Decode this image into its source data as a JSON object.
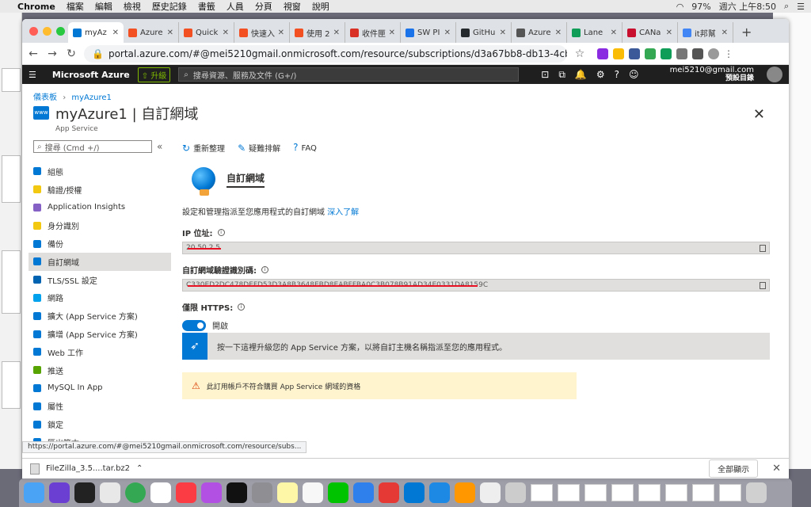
{
  "menubar": {
    "app": "Chrome",
    "items": [
      "檔案",
      "編輯",
      "檢視",
      "歷史記錄",
      "書籤",
      "人員",
      "分頁",
      "視窗",
      "說明"
    ],
    "battery": "97%",
    "clock": "週六 上午8:50"
  },
  "browser": {
    "tabs": [
      {
        "label": "myAz",
        "color": "#0078d4"
      },
      {
        "label": "Azure",
        "color": "#f25022"
      },
      {
        "label": "Quick",
        "color": "#f25022"
      },
      {
        "label": "快速入",
        "color": "#f25022"
      },
      {
        "label": "使用 2",
        "color": "#f25022"
      },
      {
        "label": "收件匣",
        "color": "#d93025"
      },
      {
        "label": "SW PI",
        "color": "#1a73e8"
      },
      {
        "label": "GitHu",
        "color": "#24292e"
      },
      {
        "label": "Azure",
        "color": "#555555"
      },
      {
        "label": "Lane",
        "color": "#0f9d58"
      },
      {
        "label": "CANa",
        "color": "#c8102e"
      },
      {
        "label": "it邦幫",
        "color": "#4285f4"
      }
    ],
    "url": "portal.azure.com/#@mei5210gmail.onmicrosoft.com/resource/subscriptions/d3a67bb8-db13-4cbf-8846-1d2ec6ba50a0/re...",
    "status_url": "https://portal.azure.com/#@mei5210gmail.onmicrosoft.com/resource/subs..."
  },
  "azure": {
    "brand": "Microsoft Azure",
    "upgrade": "升級",
    "search_placeholder": "搜尋資源、服務及文件 (G+/)",
    "user_email": "mei5210@gmail.com",
    "user_directory": "預設目錄"
  },
  "breadcrumb": [
    "儀表板",
    "myAzure1"
  ],
  "title": {
    "main": "myAzure1 | 自訂網域",
    "subtitle": "App Service",
    "icon_text": "www"
  },
  "sidebar": {
    "search_placeholder": "搜尋 (Cmd +/)",
    "items": [
      {
        "label": "組態",
        "color": "#0078d4"
      },
      {
        "label": "驗證/授權",
        "color": "#f2c811"
      },
      {
        "label": "Application Insights",
        "color": "#8661c5"
      },
      {
        "label": "身分識別",
        "color": "#f2c811"
      },
      {
        "label": "備份",
        "color": "#0078d4"
      },
      {
        "label": "自訂網域",
        "color": "#0078d4",
        "selected": true
      },
      {
        "label": "TLS/SSL 設定",
        "color": "#0063b1"
      },
      {
        "label": "網路",
        "color": "#00a2ed"
      },
      {
        "label": "擴大 (App Service 方案)",
        "color": "#0078d4"
      },
      {
        "label": "擴增 (App Service 方案)",
        "color": "#0078d4"
      },
      {
        "label": "Web 工作",
        "color": "#0078d4"
      },
      {
        "label": "推送",
        "color": "#57a300"
      },
      {
        "label": "MySQL In App",
        "color": "#0078d4"
      },
      {
        "label": "屬性",
        "color": "#0078d4"
      },
      {
        "label": "鎖定",
        "color": "#0078d4"
      },
      {
        "label": "匯出範本",
        "color": "#0078d4"
      }
    ]
  },
  "commands": {
    "refresh": "重新整理",
    "troubleshoot": "疑難排解",
    "faq": "FAQ"
  },
  "content": {
    "hero_title": "自訂網域",
    "description": "設定和管理指派至您應用程式的自訂網域",
    "learn_more": "深入了解",
    "ip_label": "IP 位址:",
    "ip_value": "20.50.2.5",
    "verification_label": "自訂網域驗證識別碼:",
    "verification_value": "C330ED2DC478DEFD53D3A8B3648EBD8EABFFBA0C3B078B91AD34E0331DA8159C",
    "https_label": "僅限 HTTPS:",
    "https_state": "開啟",
    "upsell_text": "按一下這裡升級您的 App Service 方案，以將自訂主機名稱指派至您的應用程式。",
    "warning_text": "此訂用帳戶不符合購買 App Service 網域的資格"
  },
  "downloads": {
    "file": "FileZilla_3.5....tar.bz2",
    "show_all": "全部顯示"
  }
}
